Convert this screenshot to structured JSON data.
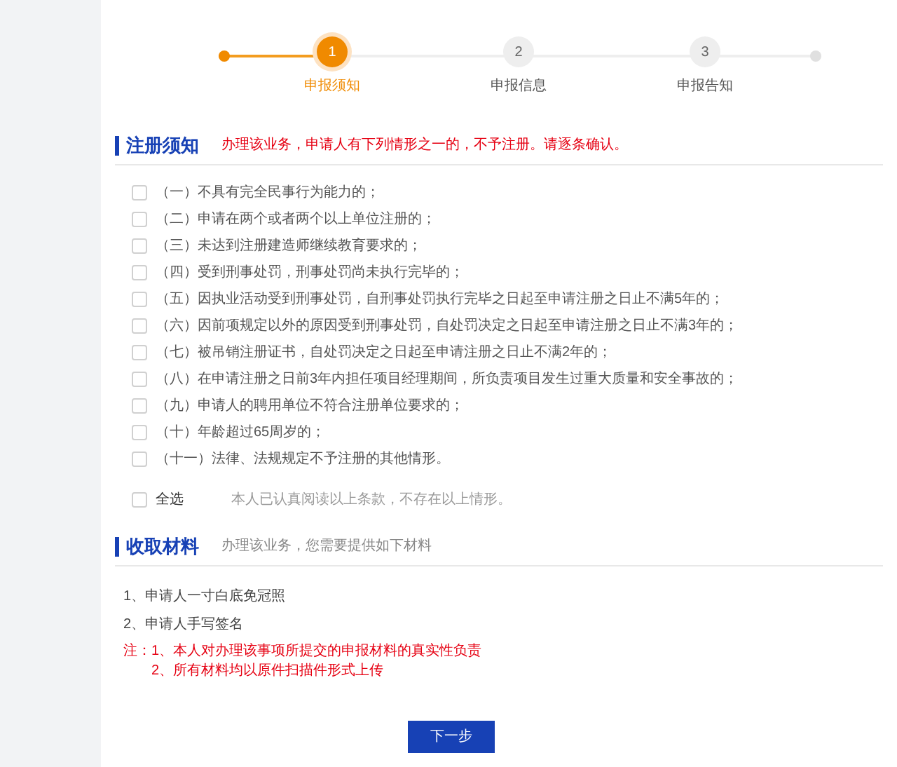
{
  "steps": [
    {
      "number": "1",
      "label": "申报须知",
      "selected": true
    },
    {
      "number": "2",
      "label": "申报信息",
      "selected": false
    },
    {
      "number": "3",
      "label": "申报告知",
      "selected": false
    }
  ],
  "notice": {
    "title": "注册须知",
    "hint": "办理该业务，申请人有下列情形之一的，不予注册。请逐条确认。",
    "items": [
      {
        "text": "（一）不具有完全民事行为能力的；",
        "checked": false
      },
      {
        "text": "（二）申请在两个或者两个以上单位注册的；",
        "checked": false
      },
      {
        "text": "（三）未达到注册建造师继续教育要求的；",
        "checked": false
      },
      {
        "text": "（四）受到刑事处罚，刑事处罚尚未执行完毕的；",
        "checked": false
      },
      {
        "text": "（五）因执业活动受到刑事处罚，自刑事处罚执行完毕之日起至申请注册之日止不满5年的；",
        "checked": false
      },
      {
        "text": "（六）因前项规定以外的原因受到刑事处罚，自处罚决定之日起至申请注册之日止不满3年的；",
        "checked": false
      },
      {
        "text": "（七）被吊销注册证书，自处罚决定之日起至申请注册之日止不满2年的；",
        "checked": false
      },
      {
        "text": "（八）在申请注册之日前3年内担任项目经理期间，所负责项目发生过重大质量和安全事故的；",
        "checked": false
      },
      {
        "text": "（九）申请人的聘用单位不符合注册单位要求的；",
        "checked": false
      },
      {
        "text": "（十）年龄超过65周岁的；",
        "checked": false
      },
      {
        "text": "（十一）法律、法规规定不予注册的其他情形。",
        "checked": false
      }
    ],
    "select_all": {
      "label": "全选",
      "checked": false
    },
    "statement": "本人已认真阅读以上条款，不存在以上情形。"
  },
  "materials": {
    "title": "收取材料",
    "hint": "办理该业务，您需要提供如下材料",
    "items": [
      "1、申请人一寸白底免冠照",
      "2、申请人手写签名"
    ],
    "note_label": "注：",
    "notes": [
      "1、本人对办理该事项所提交的申报材料的真实性负责",
      "2、所有材料均以原件扫描件形式上传"
    ]
  },
  "next_button": "下一步"
}
